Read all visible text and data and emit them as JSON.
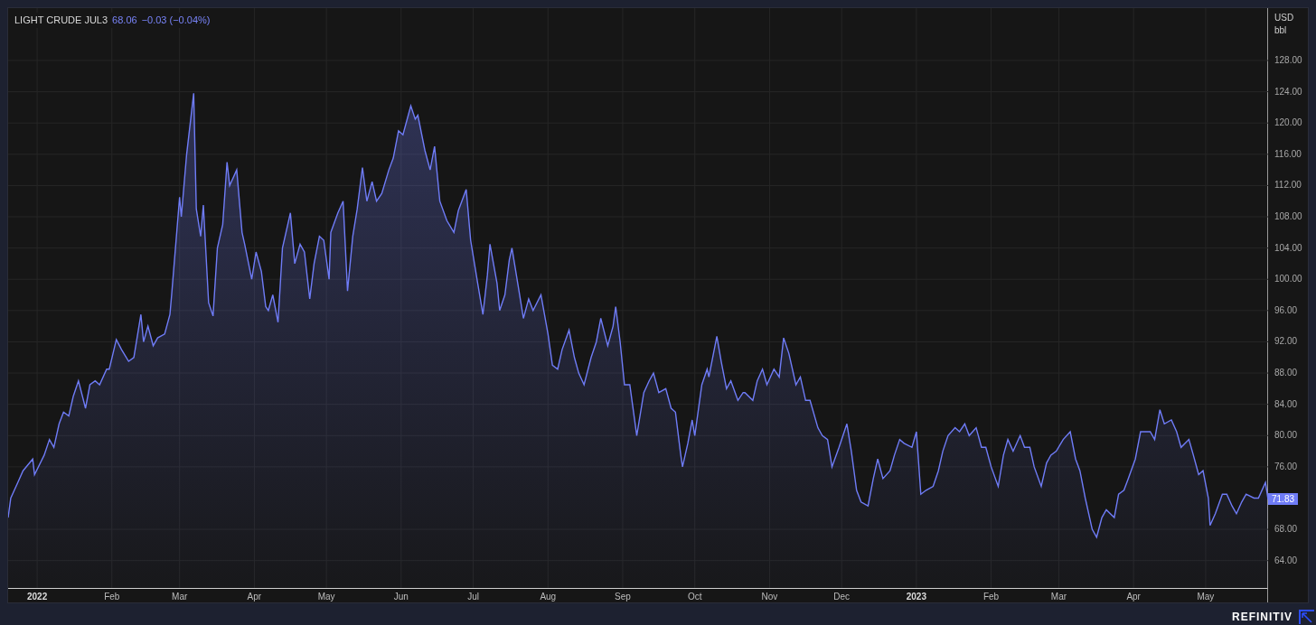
{
  "header": {
    "last": "68.06",
    "change": "−0.03 (−0.04%)"
  },
  "axis_unit": [
    "USD",
    "bbl"
  ],
  "last_price_label": "71.83",
  "chart_data": {
    "type": "area",
    "x": [
      2021.967,
      2021.97,
      2021.978,
      2021.984,
      2021.995,
      2021.997,
      2022.008,
      2022.014,
      2022.019,
      2022.025,
      2022.03,
      2022.036,
      2022.041,
      2022.047,
      2022.055,
      2022.06,
      2022.066,
      2022.071,
      2022.079,
      2022.082,
      2022.09,
      2022.096,
      2022.104,
      2022.11,
      2022.118,
      2022.121,
      2022.126,
      2022.132,
      2022.137,
      2022.145,
      2022.151,
      2022.153,
      2022.162,
      2022.164,
      2022.17,
      2022.178,
      2022.181,
      2022.186,
      2022.189,
      2022.195,
      2022.2,
      2022.205,
      2022.211,
      2022.216,
      2022.219,
      2022.227,
      2022.233,
      2022.236,
      2022.244,
      2022.249,
      2022.255,
      2022.26,
      2022.263,
      2022.268,
      2022.274,
      2022.279,
      2022.288,
      2022.293,
      2022.299,
      2022.304,
      2022.31,
      2022.315,
      2022.321,
      2022.326,
      2022.332,
      2022.334,
      2022.342,
      2022.348,
      2022.353,
      2022.359,
      2022.364,
      2022.37,
      2022.375,
      2022.381,
      2022.386,
      2022.392,
      2022.4,
      2022.405,
      2022.411,
      2022.416,
      2022.425,
      2022.43,
      2022.433,
      2022.441,
      2022.447,
      2022.452,
      2022.458,
      2022.466,
      2022.474,
      2022.479,
      2022.488,
      2022.493,
      2022.501,
      2022.507,
      2022.512,
      2022.515,
      2022.523,
      2022.526,
      2022.532,
      2022.537,
      2022.54,
      2022.548,
      2022.553,
      2022.559,
      2022.564,
      2022.573,
      2022.581,
      2022.586,
      2022.592,
      2022.597,
      2022.605,
      2022.611,
      2022.616,
      2022.622,
      2022.63,
      2022.636,
      2022.641,
      2022.649,
      2022.655,
      2022.658,
      2022.663,
      2022.668,
      2022.674,
      2022.682,
      2022.69,
      2022.696,
      2022.701,
      2022.707,
      2022.715,
      2022.721,
      2022.726,
      2022.732,
      2022.734,
      2022.74,
      2022.745,
      2022.748,
      2022.756,
      2022.762,
      2022.764,
      2022.773,
      2022.778,
      2022.784,
      2022.789,
      2022.797,
      2022.803,
      2022.805,
      2022.814,
      2022.819,
      2022.825,
      2022.83,
      2022.838,
      2022.844,
      2022.849,
      2022.855,
      2022.863,
      2022.868,
      2022.874,
      2022.879,
      2022.888,
      2022.893,
      2022.899,
      2022.904,
      2022.912,
      2022.921,
      2022.926,
      2022.932,
      2022.937,
      2022.945,
      2022.951,
      2022.956,
      2022.962,
      2022.97,
      2022.975,
      2022.981,
      2022.986,
      2022.995,
      2023.0,
      2023.005,
      2023.011,
      2023.019,
      2023.025,
      2023.03,
      2023.036,
      2023.044,
      2023.049,
      2023.055,
      2023.06,
      2023.068,
      2023.074,
      2023.079,
      2023.085,
      2023.093,
      2023.099,
      2023.104,
      2023.11,
      2023.118,
      2023.123,
      2023.129,
      2023.134,
      2023.142,
      2023.148,
      2023.153,
      2023.159,
      2023.167,
      2023.175,
      2023.181,
      2023.186,
      2023.192,
      2023.2,
      2023.205,
      2023.211,
      2023.216,
      2023.225,
      2023.23,
      2023.236,
      2023.241,
      2023.249,
      2023.255,
      2023.26,
      2023.266,
      2023.271,
      2023.277,
      2023.282,
      2023.29,
      2023.296,
      2023.301,
      2023.31,
      2023.315,
      2023.321,
      2023.326,
      2023.332,
      2023.334,
      2023.34,
      2023.348,
      2023.353,
      2023.359,
      2023.364,
      2023.37,
      2023.375,
      2023.384,
      2023.389,
      2023.397,
      2023.4
    ],
    "series": [
      {
        "name": "LIGHT CRUDE JUL3",
        "color": "#6f7cf7",
        "values": [
          69.5,
          72,
          74,
          75.5,
          77,
          75,
          77.5,
          79.5,
          78.5,
          81.5,
          83,
          82.5,
          85,
          87,
          83.5,
          86.5,
          87,
          86.5,
          88.5,
          88.5,
          92.3,
          91,
          89.5,
          90,
          95.5,
          92,
          94,
          91.5,
          92.5,
          93,
          95.5,
          98,
          110.5,
          108,
          116,
          123.8,
          109,
          105.5,
          109.5,
          97,
          95.3,
          104,
          107,
          115,
          112,
          114,
          106,
          104.5,
          100,
          103.5,
          101,
          96.5,
          96,
          98,
          94.5,
          104,
          108.5,
          102,
          104.5,
          103.5,
          97.5,
          102,
          105.5,
          105,
          100,
          106,
          108.5,
          110,
          98.5,
          105.5,
          109,
          114.3,
          110,
          112.5,
          110,
          111,
          114,
          115.5,
          119,
          118.5,
          122.2,
          120.5,
          121,
          116.5,
          114,
          117,
          110,
          107.5,
          106,
          108.8,
          111.5,
          105,
          99.5,
          95.5,
          100.5,
          104.5,
          99.5,
          96,
          98,
          102.5,
          104,
          98.5,
          95,
          97.5,
          96,
          98,
          93,
          89,
          88.5,
          91,
          93.5,
          90,
          88,
          86.5,
          90,
          92,
          95,
          91.5,
          94,
          96.5,
          92,
          86.5,
          86.5,
          80,
          85.5,
          87,
          88,
          85.5,
          86,
          83.5,
          83,
          77.5,
          76,
          79,
          82,
          80,
          86.5,
          88.5,
          87.5,
          92.7,
          89.5,
          86,
          87,
          84.5,
          85.5,
          85.5,
          84.5,
          87,
          88.5,
          86.5,
          88.5,
          87.5,
          92.5,
          90.5,
          86.5,
          87.5,
          84.5,
          84.5,
          81,
          80,
          79.5,
          76,
          78.5,
          81.5,
          78,
          73,
          71.5,
          71,
          74.5,
          77,
          74.5,
          75.5,
          77.5,
          79.5,
          79,
          78.5,
          80.5,
          72.5,
          73,
          73.5,
          75.5,
          78,
          80,
          81,
          80.5,
          81.5,
          80,
          81,
          78.5,
          78.5,
          76,
          73.5,
          77.5,
          79.5,
          78,
          80,
          78.5,
          78.5,
          76,
          73.5,
          76.5,
          77.5,
          78,
          79.5,
          80.5,
          77,
          75.5,
          72,
          68,
          67,
          69.5,
          70.5,
          69.5,
          72.5,
          73,
          74.5,
          77,
          80.5,
          80.5,
          80.5,
          79.5,
          83.3,
          81.5,
          82,
          80.5,
          78.5,
          79.5,
          77.5,
          75,
          75.5,
          72,
          68.5,
          70,
          72.5,
          72.5,
          71,
          70,
          71.5,
          72.5,
          72,
          72,
          74,
          71.8
        ]
      }
    ],
    "grid": true,
    "xlim": [
      2021.967,
      2023.4
    ],
    "ylim": [
      60.5,
      134.7
    ],
    "xticks": [
      {
        "value": 2022,
        "label": "2022"
      },
      {
        "value": 2022.085,
        "label": "Feb"
      },
      {
        "value": 2022.162,
        "label": "Mar"
      },
      {
        "value": 2022.247,
        "label": "Apr"
      },
      {
        "value": 2022.329,
        "label": "May"
      },
      {
        "value": 2022.414,
        "label": "Jun"
      },
      {
        "value": 2022.496,
        "label": "Jul"
      },
      {
        "value": 2022.581,
        "label": "Aug"
      },
      {
        "value": 2022.666,
        "label": "Sep"
      },
      {
        "value": 2022.748,
        "label": "Oct"
      },
      {
        "value": 2022.833,
        "label": "Nov"
      },
      {
        "value": 2022.915,
        "label": "Dec"
      },
      {
        "value": 2023,
        "label": "2023"
      },
      {
        "value": 2023.085,
        "label": "Feb"
      },
      {
        "value": 2023.162,
        "label": "Mar"
      },
      {
        "value": 2023.247,
        "label": "Apr"
      },
      {
        "value": 2023.329,
        "label": "May"
      }
    ],
    "yticks": [
      {
        "value": 64,
        "label": "64.00"
      },
      {
        "value": 68,
        "label": "68.00"
      },
      {
        "value": 76,
        "label": "76.00"
      },
      {
        "value": 80,
        "label": "80.00"
      },
      {
        "value": 84,
        "label": "84.00"
      },
      {
        "value": 88,
        "label": "88.00"
      },
      {
        "value": 92,
        "label": "92.00"
      },
      {
        "value": 96,
        "label": "96.00"
      },
      {
        "value": 100,
        "label": "100.00"
      },
      {
        "value": 104,
        "label": "104.00"
      },
      {
        "value": 108,
        "label": "108.00"
      },
      {
        "value": 112,
        "label": "112.00"
      },
      {
        "value": 116,
        "label": "116.00"
      },
      {
        "value": 120,
        "label": "120.00"
      },
      {
        "value": 124,
        "label": "124.00"
      },
      {
        "value": 128,
        "label": "128.00"
      }
    ]
  },
  "brand": "REFINITIV"
}
